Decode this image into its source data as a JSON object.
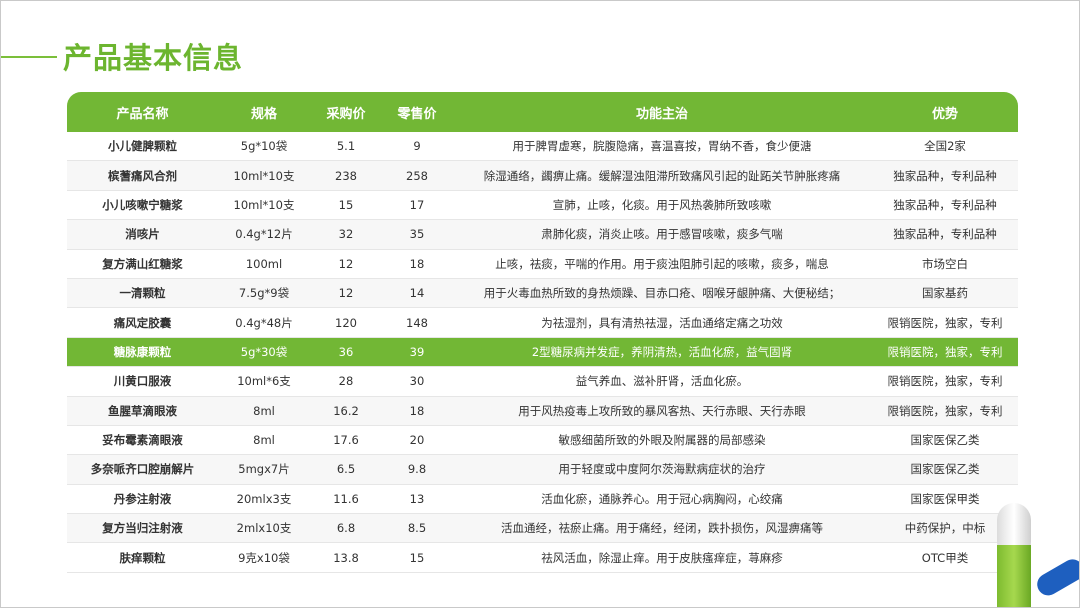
{
  "page": {
    "title": "产品基本信息"
  },
  "table": {
    "headers": {
      "name": "产品名称",
      "spec": "规格",
      "purchase": "采购价",
      "retail": "零售价",
      "function": "功能主治",
      "advantage": "优势"
    },
    "rows": [
      {
        "name": "小儿健脾颗粒",
        "spec": "5g*10袋",
        "purchase": "5.1",
        "retail": "9",
        "function": "用于脾胃虚寒，脘腹隐痛，喜温喜按，胃纳不香，食少便溏",
        "advantage": "全国2家"
      },
      {
        "name": "槟蓍痛风合剂",
        "spec": "10ml*10支",
        "purchase": "238",
        "retail": "258",
        "function": "除湿通络，蠲痹止痛。缓解湿浊阻滞所致痛风引起的趾跖关节肿胀疼痛",
        "advantage": "独家品种，专利品种"
      },
      {
        "name": "小儿咳嗽宁糖浆",
        "spec": "10ml*10支",
        "purchase": "15",
        "retail": "17",
        "function": "宣肺，止咳，化痰。用于风热袭肺所致咳嗽",
        "advantage": "独家品种，专利品种"
      },
      {
        "name": "消咳片",
        "spec": "0.4g*12片",
        "purchase": "32",
        "retail": "35",
        "function": "肃肺化痰，消炎止咳。用于感冒咳嗽，痰多气喘",
        "advantage": "独家品种，专利品种"
      },
      {
        "name": "复方满山红糖浆",
        "spec": "100ml",
        "purchase": "12",
        "retail": "18",
        "function": "止咳，祛痰，平喘的作用。用于痰浊阻肺引起的咳嗽，痰多，喘息",
        "advantage": "市场空白"
      },
      {
        "name": "一清颗粒",
        "spec": "7.5g*9袋",
        "purchase": "12",
        "retail": "14",
        "function": "用于火毒血热所致的身热烦躁、目赤口疮、咽喉牙龈肿痛、大便秘结；",
        "advantage": "国家基药"
      },
      {
        "name": "痛风定胶囊",
        "spec": "0.4g*48片",
        "purchase": "120",
        "retail": "148",
        "function": "为祛湿剂，具有清热祛湿，活血通络定痛之功效",
        "advantage": "限销医院，独家，专利"
      },
      {
        "name": "糖脉康颗粒",
        "spec": "5g*30袋",
        "purchase": "36",
        "retail": "39",
        "function": "2型糖尿病并发症，养阴清热，活血化瘀，益气固肾",
        "advantage": "限销医院，独家，专利",
        "highlight": true
      },
      {
        "name": "川黄口服液",
        "spec": "10ml*6支",
        "purchase": "28",
        "retail": "30",
        "function": "益气养血、滋补肝肾，活血化瘀。",
        "advantage": "限销医院，独家，专利"
      },
      {
        "name": "鱼腥草滴眼液",
        "spec": "8ml",
        "purchase": "16.2",
        "retail": "18",
        "function": "用于风热疫毒上攻所致的暴风客热、天行赤眼、天行赤眼",
        "advantage": "限销医院，独家，专利"
      },
      {
        "name": "妥布霉素滴眼液",
        "spec": "8ml",
        "purchase": "17.6",
        "retail": "20",
        "function": "敏感细菌所致的外眼及附属器的局部感染",
        "advantage": "国家医保乙类"
      },
      {
        "name": "多奈哌齐口腔崩解片",
        "spec": "5mgx7片",
        "purchase": "6.5",
        "retail": "9.8",
        "function": "用于轻度或中度阿尔茨海默病症状的治疗",
        "advantage": "国家医保乙类"
      },
      {
        "name": "丹参注射液",
        "spec": "20mlx3支",
        "purchase": "11.6",
        "retail": "13",
        "function": "活血化瘀，通脉养心。用于冠心病胸闷，心绞痛",
        "advantage": "国家医保甲类"
      },
      {
        "name": "复方当归注射液",
        "spec": "2mlx10支",
        "purchase": "6.8",
        "retail": "8.5",
        "function": "活血通经，祛瘀止痛。用于痛经，经闭，跌扑损伤，风湿痹痛等",
        "advantage": "中药保护，中标"
      },
      {
        "name": "肤痒颗粒",
        "spec": "9克x10袋",
        "purchase": "13.8",
        "retail": "15",
        "function": "祛风活血，除湿止痒。用于皮肤瘙痒症，荨麻疹",
        "advantage": "OTC甲类"
      }
    ]
  },
  "colors": {
    "accent": "#72b735",
    "title": "#6cb52f",
    "row_alt": "#f7f7f7"
  },
  "decoration": {
    "icon": "capsule-icon"
  }
}
